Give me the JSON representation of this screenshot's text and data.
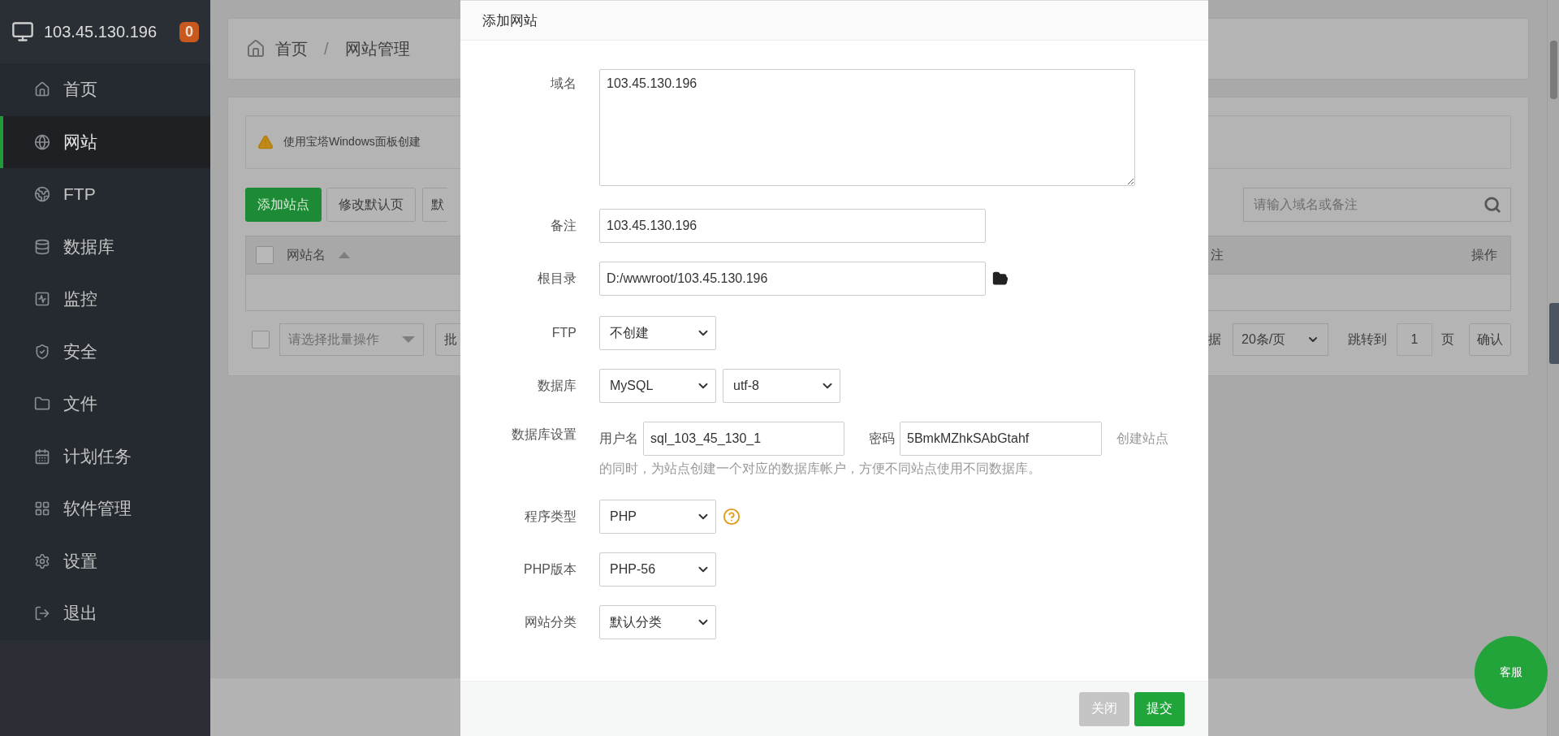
{
  "sidebar": {
    "host": "103.45.130.196",
    "badge": "0",
    "items": [
      {
        "label": "首页",
        "selected": false
      },
      {
        "label": "网站",
        "selected": true
      },
      {
        "label": "FTP",
        "selected": false
      },
      {
        "label": "数据库",
        "selected": false
      },
      {
        "label": "监控",
        "selected": false
      },
      {
        "label": "安全",
        "selected": false
      },
      {
        "label": "文件",
        "selected": false
      },
      {
        "label": "计划任务",
        "selected": false
      },
      {
        "label": "软件管理",
        "selected": false
      },
      {
        "label": "设置",
        "selected": false
      },
      {
        "label": "退出",
        "selected": false
      }
    ]
  },
  "breadcrumb": [
    "首页",
    "/",
    "网站管理"
  ],
  "notice": "使用宝塔Windows面板创建",
  "toolbar": {
    "buttons": [
      {
        "label": "添加站点",
        "primary": true
      },
      {
        "label": "修改默认页",
        "primary": false
      },
      {
        "label": "默",
        "primary": false
      }
    ],
    "search": {
      "placeholder": "请输入域名或备注"
    }
  },
  "table": {
    "columns": [
      "网站名",
      "注",
      "操作"
    ],
    "all_checked": false
  },
  "pagination": {
    "all_checked": false,
    "batch_placeholder": "请选择批量操作",
    "batch_button": "批",
    "total_fragment": "据",
    "page_size": "20条/页",
    "jump_label": "跳转到",
    "page": "1",
    "page_unit": "页",
    "confirm": "确认"
  },
  "dialog": {
    "title": "添加网站",
    "fields": [
      {
        "kind": "textarea",
        "label": "域名",
        "value": "103.45.130.196"
      },
      {
        "kind": "input",
        "label": "备注",
        "value": "103.45.130.196"
      },
      {
        "kind": "path",
        "label": "根目录",
        "value": "D:/wwwroot/103.45.130.196"
      },
      {
        "kind": "select",
        "label": "FTP",
        "values": [
          "不创建"
        ],
        "help": false
      },
      {
        "kind": "select",
        "label": "数据库",
        "values": [
          "MySQL",
          "utf-8"
        ],
        "help": false
      },
      {
        "kind": "credentials",
        "label": "数据库设置",
        "user_label": "用户名",
        "user": "sql_103_45_130_1",
        "password_label": "密码",
        "password": "5BmkMZhkSAbGtahf",
        "hint": [
          "创建站点",
          "的同时，为站点创建一个对应的数据库帐户，方便不同站点使用不同数据库。"
        ]
      },
      {
        "kind": "select",
        "label": "程序类型",
        "values": [
          "PHP"
        ],
        "help": true
      },
      {
        "kind": "select",
        "label": "PHP版本",
        "values": [
          "PHP-56"
        ],
        "help": false
      },
      {
        "kind": "select",
        "label": "网站分类",
        "values": [
          "默认分类"
        ],
        "help": false
      }
    ],
    "buttons": [
      {
        "label": "关闭",
        "kind": "secondary"
      },
      {
        "label": "提交",
        "kind": "primary"
      }
    ]
  },
  "support_button": "客服"
}
